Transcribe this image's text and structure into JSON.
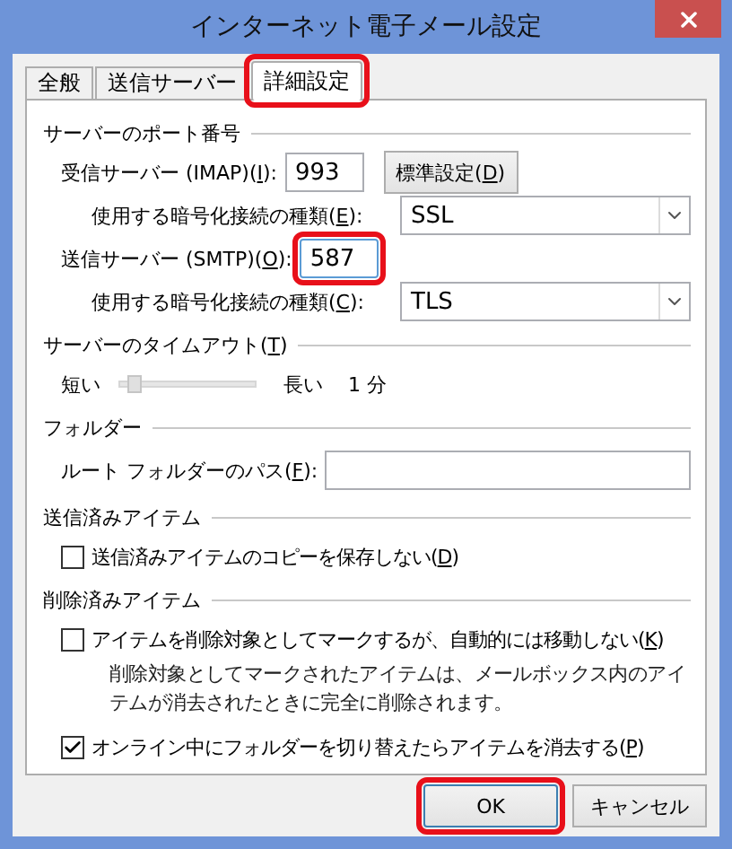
{
  "window": {
    "title": "インターネット電子メール設定"
  },
  "tabs": [
    {
      "label": "全般",
      "selected": false,
      "highlighted": false
    },
    {
      "label": "送信サーバー",
      "selected": false,
      "highlighted": false
    },
    {
      "label": "詳細設定",
      "selected": true,
      "highlighted": true
    }
  ],
  "sections": [
    {
      "title": [
        "サーバーのポート番号"
      ],
      "rows": [
        {
          "kind": "port",
          "label": [
            "受信サーバー (IMAP)(",
            "I",
            "):"
          ],
          "value": "993",
          "highlighted": false,
          "button": [
            "標準設定(",
            "D",
            ")"
          ]
        },
        {
          "kind": "select",
          "label": [
            "使用する暗号化接続の種類(",
            "E",
            "):"
          ],
          "value": "SSL"
        },
        {
          "kind": "port",
          "label": [
            "送信サーバー (SMTP)(",
            "O",
            "):"
          ],
          "value": "587",
          "highlighted": true
        },
        {
          "kind": "select",
          "label": [
            "使用する暗号化接続の種類(",
            "C",
            "):"
          ],
          "value": "TLS"
        }
      ]
    },
    {
      "title": [
        "サーバーのタイムアウト(",
        "T",
        ")"
      ],
      "rows": [
        {
          "kind": "slider",
          "left": "短い",
          "right": "長い",
          "reading": "1 分",
          "level": 0.1
        }
      ]
    },
    {
      "title": [
        "フォルダー"
      ],
      "rows": [
        {
          "kind": "text",
          "label": [
            "ルート フォルダーのパス(",
            "F",
            "):"
          ]
        }
      ]
    },
    {
      "title": [
        "送信済みアイテム"
      ],
      "rows": [
        {
          "kind": "checkbox",
          "label": [
            "送信済みアイテムのコピーを保存しない(",
            "D",
            ")"
          ],
          "checked": false
        }
      ]
    },
    {
      "title": [
        "削除済みアイテム"
      ],
      "rows": [
        {
          "kind": "checkbox",
          "label": [
            "アイテムを削除対象としてマークするが、自動的には移動しない(",
            "K",
            ")"
          ],
          "checked": false,
          "note": "削除対象としてマークされたアイテムは、メールボックス内のアイテムが消去されたときに完全に削除されます。"
        },
        {
          "kind": "checkbox",
          "label": [
            "オンライン中にフォルダーを切り替えたらアイテムを消去する(",
            "P",
            ")"
          ],
          "checked": true
        }
      ]
    }
  ],
  "buttons": [
    {
      "label": "OK",
      "default": true,
      "highlighted": true
    },
    {
      "label": "キャンセル",
      "default": false,
      "highlighted": false
    }
  ]
}
